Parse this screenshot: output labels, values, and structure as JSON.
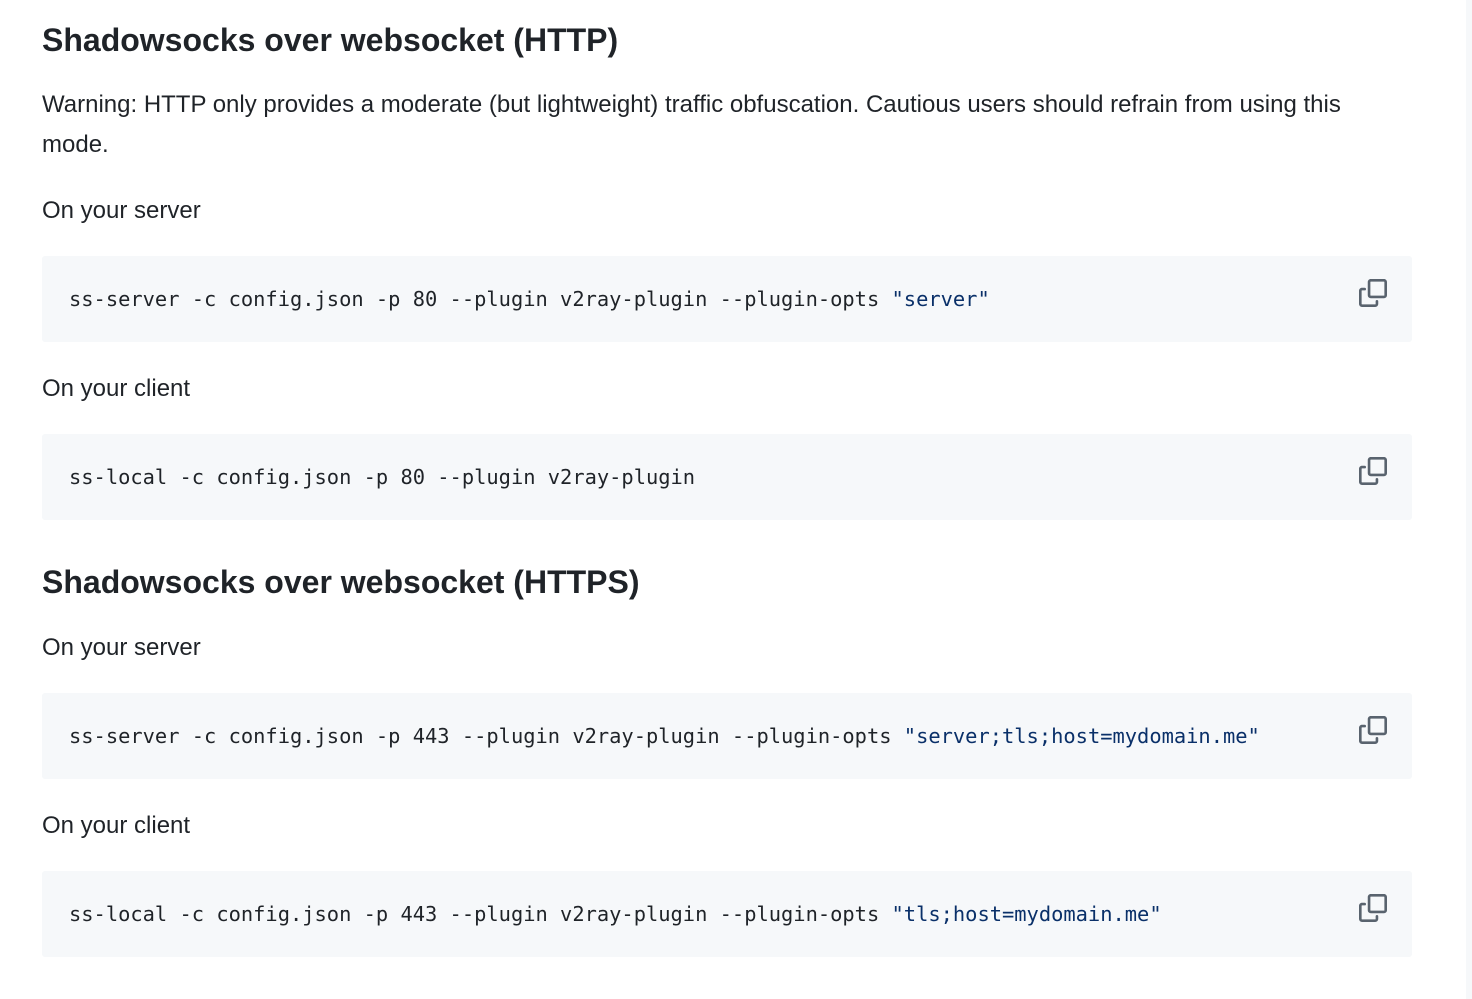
{
  "sections": [
    {
      "heading": "Shadowsocks over websocket (HTTP)",
      "warning": "Warning: HTTP only provides a moderate (but lightweight) traffic obfuscation. Cautious users should refrain from using this mode.",
      "server_label": "On your server",
      "server_cmd": "ss-server -c config.json -p 80 --plugin v2ray-plugin --plugin-opts ",
      "server_opts": "\"server\"",
      "client_label": "On your client",
      "client_cmd": "ss-local -c config.json -p 80 --plugin v2ray-plugin",
      "client_opts": ""
    },
    {
      "heading": "Shadowsocks over websocket (HTTPS)",
      "server_label": "On your server",
      "server_cmd": "ss-server -c config.json -p 443 --plugin v2ray-plugin --plugin-opts ",
      "server_opts": "\"server;tls;host=mydomain.me\"",
      "client_label": "On your client",
      "client_cmd": "ss-local -c config.json -p 443 --plugin v2ray-plugin --plugin-opts ",
      "client_opts": "\"tls;host=mydomain.me\""
    }
  ],
  "icons": {
    "copy": "copy-icon"
  },
  "colors": {
    "text": "#1f2328",
    "code_bg": "#f6f8fa",
    "string": "#0a3069",
    "icon": "#59636e"
  }
}
